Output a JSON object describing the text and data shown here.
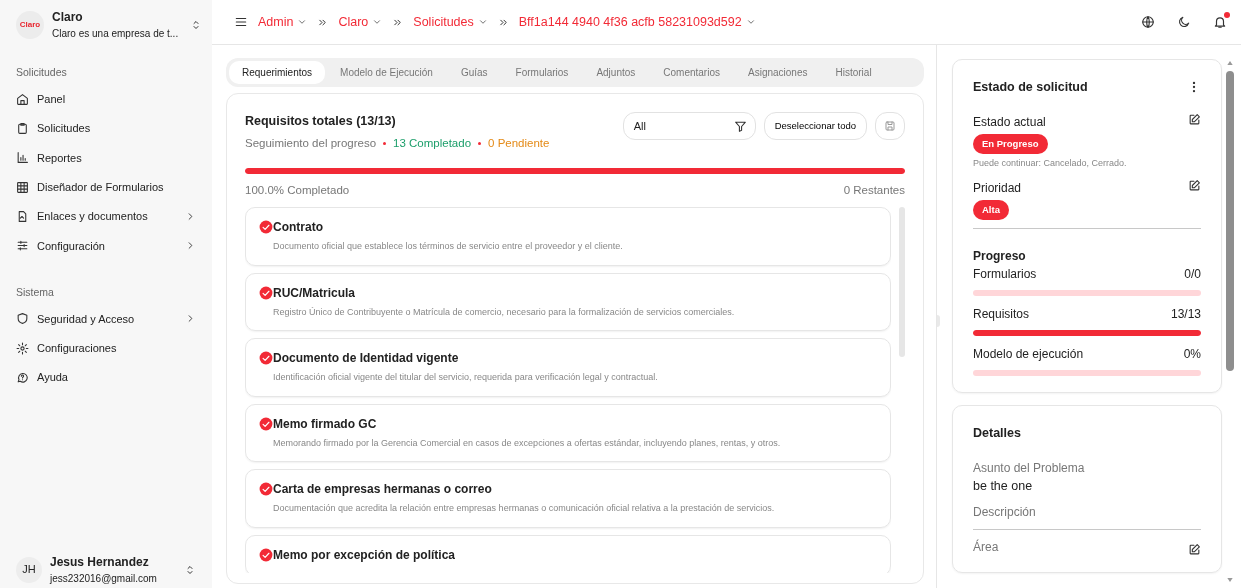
{
  "sidebar": {
    "brand": {
      "logo": "Claro",
      "name": "Claro",
      "subtitle": "Claro es una empresa de t..."
    },
    "sections": [
      {
        "title": "Solicitudes",
        "items": [
          {
            "label": "Panel",
            "submenu": false
          },
          {
            "label": "Solicitudes",
            "submenu": false
          },
          {
            "label": "Reportes",
            "submenu": false
          },
          {
            "label": "Diseñador de Formularios",
            "submenu": false
          },
          {
            "label": "Enlaces y documentos",
            "submenu": true
          },
          {
            "label": "Configuración",
            "submenu": true
          }
        ]
      },
      {
        "title": "Sistema",
        "items": [
          {
            "label": "Seguridad y Acceso",
            "submenu": true
          },
          {
            "label": "Configuraciones",
            "submenu": false
          },
          {
            "label": "Ayuda",
            "submenu": false
          }
        ]
      }
    ],
    "user": {
      "initials": "JH",
      "name": "Jesus Hernandez",
      "email": "jess232016@gmail.com"
    }
  },
  "breadcrumbs": [
    "Admin",
    "Claro",
    "Solicitudes",
    "Bff1a144 4940 4f36 acfb 58231093d592"
  ],
  "topbar": {
    "notification": true
  },
  "tabs": [
    {
      "label": "Requerimientos",
      "selected": true
    },
    {
      "label": "Modelo de Ejecución",
      "selected": false
    },
    {
      "label": "Guías",
      "selected": false
    },
    {
      "label": "Formularios",
      "selected": false
    },
    {
      "label": "Adjuntos",
      "selected": false
    },
    {
      "label": "Comentarios",
      "selected": false
    },
    {
      "label": "Asignaciones",
      "selected": false
    },
    {
      "label": "Historial",
      "selected": false
    }
  ],
  "requirements": {
    "title": "Requisitos totales (13/13)",
    "subtitle": "Seguimiento del progreso",
    "completed": "13 Completado",
    "pending": "0 Pendiente",
    "filter": {
      "value": "All"
    },
    "deselect_button": "Deseleccionar todo",
    "level": 1,
    "percent": "100.0% Completado",
    "remaining": "0 Restantes",
    "items": [
      {
        "title": "Contrato",
        "description": "Documento oficial que establece los términos de servicio entre el proveedor y el cliente.",
        "completed": true
      },
      {
        "title": "RUC/Matricula",
        "description": "Registro Único de Contribuyente o Matrícula de comercio, necesario para la formalización de servicios comerciales.",
        "completed": true
      },
      {
        "title": "Documento de Identidad vigente",
        "description": "Identificación oficial vigente del titular del servicio, requerida para verificación legal y contractual.",
        "completed": true
      },
      {
        "title": "Memo firmado GC",
        "description": "Memorando firmado por la Gerencia Comercial en casos de excepciones a ofertas estándar, incluyendo planes, rentas, y otros.",
        "completed": true
      },
      {
        "title": "Carta de empresas hermanas o correo",
        "description": "Documentación que acredita la relación entre empresas hermanas o comunicación oficial relativa a la prestación de servicios.",
        "completed": true
      },
      {
        "title": "Memo por excepción de política",
        "completed": true
      }
    ]
  },
  "status_card": {
    "title": "Estado de solicitud",
    "current_label": "Estado actual",
    "current_value": "En Progreso",
    "hint": "Puede continuar: Cancelado, Cerrado.",
    "priority_label": "Prioridad",
    "priority_value": "Alta",
    "progress_title": "Progreso",
    "progress": [
      {
        "label": "Formularios",
        "reading": "0/0",
        "level": 0
      },
      {
        "label": "Requisitos",
        "reading": "13/13",
        "level": 1
      },
      {
        "label": "Modelo de ejecución",
        "reading": "0%",
        "level": 0
      }
    ]
  },
  "details_card": {
    "title": "Detalles",
    "fields": [
      {
        "label": "Asunto del Problema",
        "value": "be the one"
      },
      {
        "label": "Descripción"
      }
    ],
    "area_label": "Área"
  }
}
